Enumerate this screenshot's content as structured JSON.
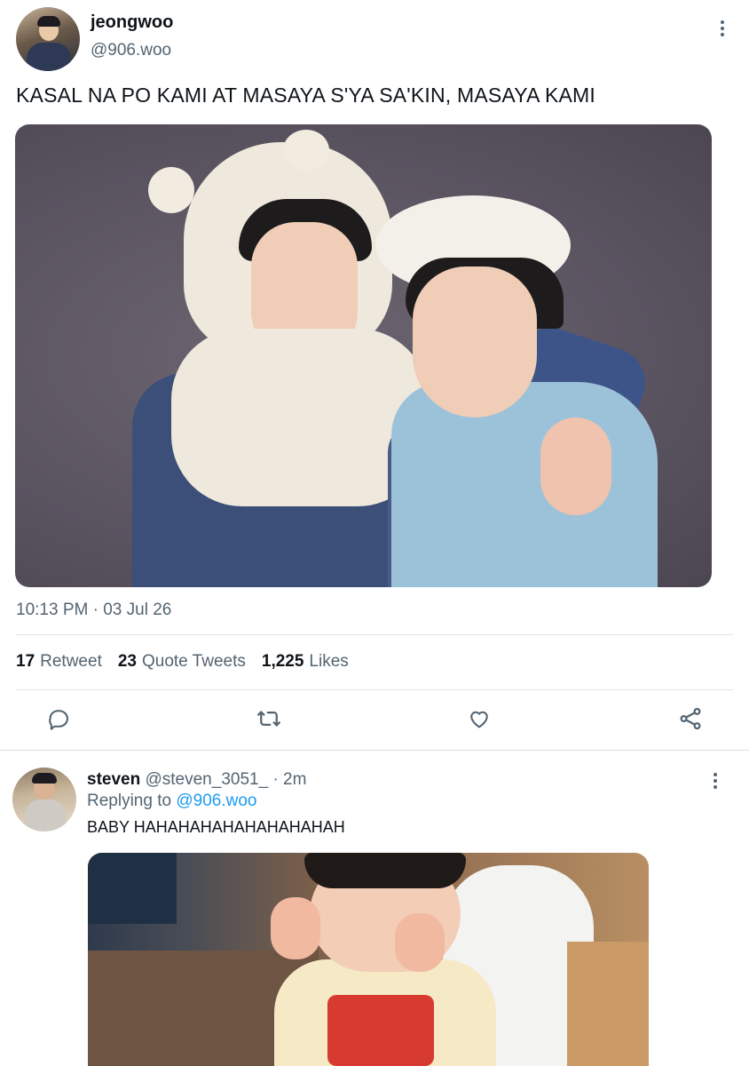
{
  "tweet": {
    "author_name": "jeongwoo",
    "author_handle": "@906.woo",
    "text": "KASAL NA PO KAMI AT MASAYA S'YA SA'KIN, MASAYA KAMI",
    "timestamp": "10:13 PM · 03 Jul 26",
    "stats": {
      "retweets_count": "17",
      "retweets_label": "Retweet",
      "quotes_count": "23",
      "quotes_label": "Quote Tweets",
      "likes_count": "1,225",
      "likes_label": "Likes"
    },
    "actions": [
      "reply-icon",
      "retweet-icon",
      "like-icon",
      "share-icon"
    ]
  },
  "reply": {
    "author_name": "steven",
    "author_handle": "@steven_3051_",
    "separator": "·",
    "time": "2m",
    "replying_prefix": "Replying to",
    "replying_handle": "@906.woo",
    "text": "BABY HAHAHAHAHAHAHAHAHAH"
  },
  "colors": {
    "text_primary": "#0f1419",
    "text_secondary": "#536471",
    "link": "#1d9bf0",
    "divider": "#e1e6ea"
  }
}
